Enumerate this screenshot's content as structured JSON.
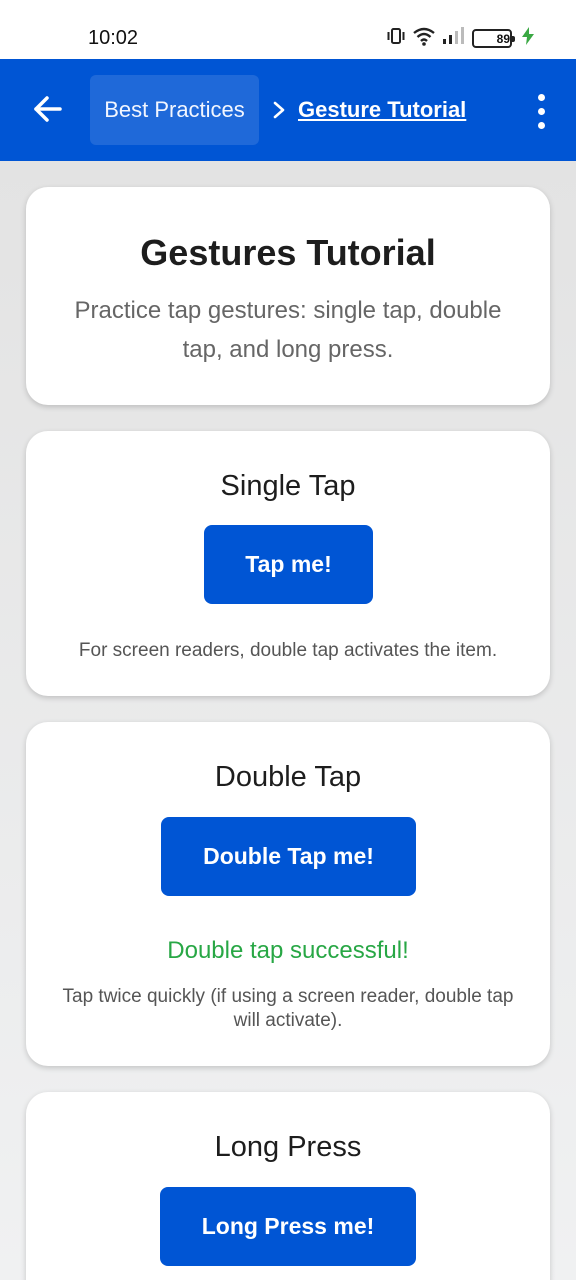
{
  "status_bar": {
    "time": "10:02",
    "battery_level": "89",
    "icons": [
      "vibrate-icon",
      "wifi-icon",
      "signal-icon",
      "battery-icon",
      "charging-icon"
    ]
  },
  "app_bar": {
    "back_icon": "arrow-left-icon",
    "breadcrumb_parent": "Best Practices",
    "breadcrumb_separator_icon": "chevron-right-icon",
    "breadcrumb_current": "Gesture Tutorial",
    "menu_icon": "more-vertical-icon"
  },
  "intro": {
    "title": "Gestures Tutorial",
    "description": "Practice tap gestures: single tap, double tap, and long press."
  },
  "single_tap": {
    "title": "Single Tap",
    "button": "Tap me!",
    "note": "For screen readers, double tap activates the item."
  },
  "double_tap": {
    "title": "Double Tap",
    "button": "Double Tap me!",
    "success": "Double tap successful!",
    "note": "Tap twice quickly (if using a screen reader, double tap will activate)."
  },
  "long_press": {
    "title": "Long Press",
    "button": "Long Press me!"
  },
  "colors": {
    "primary": "#0055d4",
    "success": "#28a745",
    "background": "#e9e9e9",
    "card": "#ffffff"
  }
}
